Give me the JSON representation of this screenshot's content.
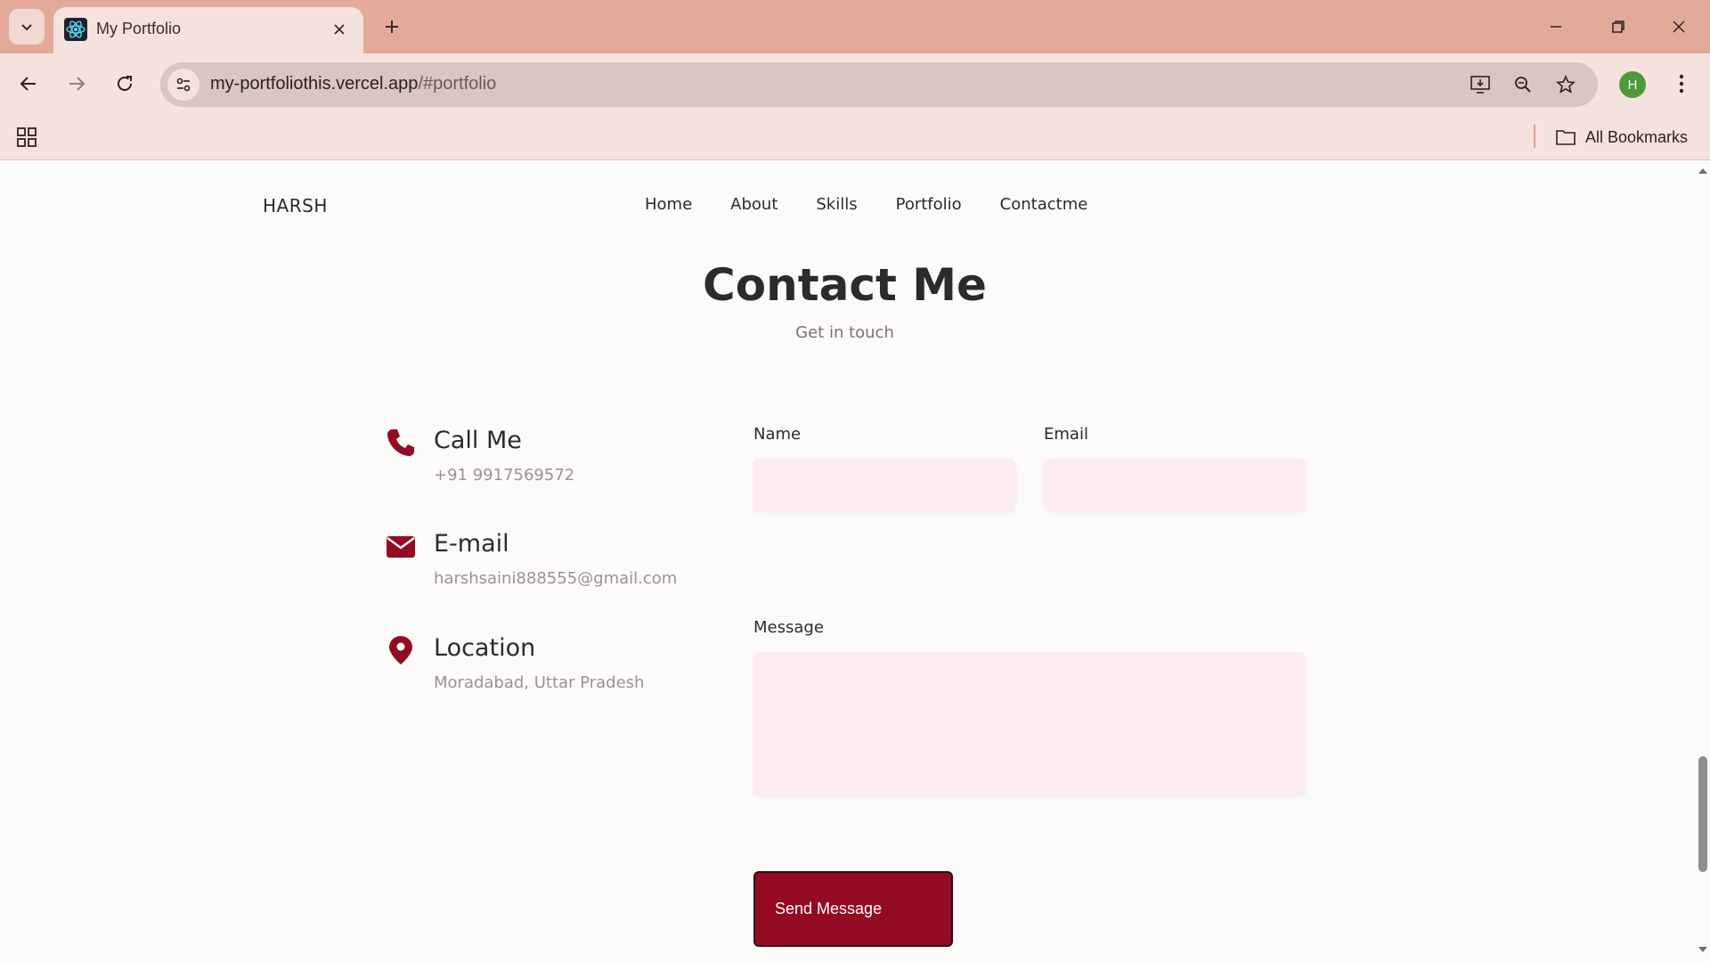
{
  "browser": {
    "tab_title": "My Portfolio",
    "url_host": "my-portfoliothis.vercel.app",
    "url_path": "/#portfolio",
    "profile_initial": "H",
    "all_bookmarks_label": "All Bookmarks",
    "icons": [
      "tab-search-icon",
      "react-favicon-icon",
      "close-icon",
      "plus-icon",
      "minimize-icon",
      "restore-icon",
      "close-window-icon",
      "back-arrow-icon",
      "forward-arrow-icon",
      "reload-icon",
      "site-settings-icon",
      "install-app-icon",
      "zoom-icon",
      "star-icon",
      "more-vert-icon",
      "apps-grid-icon",
      "folder-icon"
    ]
  },
  "site": {
    "logo": "HARSH",
    "nav": [
      "Home",
      "About",
      "Skills",
      "Portfolio",
      "Contactme"
    ]
  },
  "contact": {
    "title": "Contact Me",
    "subtitle": "Get in touch",
    "items": [
      {
        "title": "Call Me",
        "value": "+91 9917569572",
        "icon": "phone-icon"
      },
      {
        "title": "E-mail",
        "value": "harshsaini888555@gmail.com",
        "icon": "envelope-icon"
      },
      {
        "title": "Location",
        "value": "Moradabad, Uttar Pradesh",
        "icon": "map-pin-icon"
      }
    ],
    "form": {
      "name_label": "Name",
      "name_value": "",
      "email_label": "Email",
      "email_value": "",
      "message_label": "Message",
      "message_value": "",
      "submit_label": "Send Message"
    }
  },
  "colors": {
    "tabbar": "#e3aa9a",
    "toolbar": "#f5e2de",
    "accent": "#930a22",
    "input_bg": "#fcecf0"
  }
}
